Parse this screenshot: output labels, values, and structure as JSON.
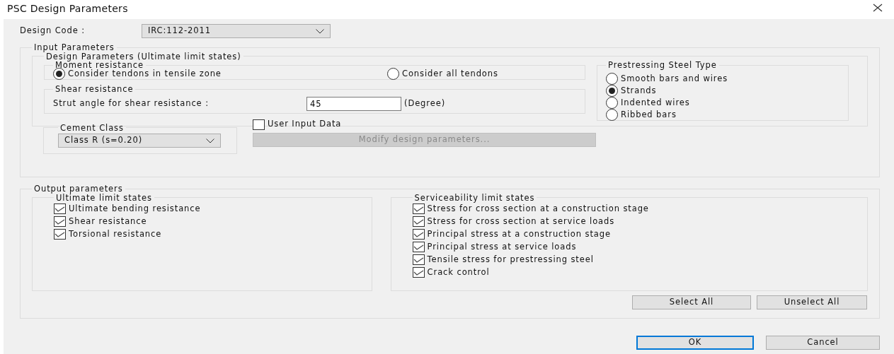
{
  "window": {
    "title": "PSC Design Parameters"
  },
  "design_code": {
    "label": "Design Code :",
    "value": "IRC:112-2011"
  },
  "input_parameters": {
    "title": "Input Parameters",
    "design_parameters": {
      "title": "Design Parameters (Ultimate limit states)",
      "moment_resistance": {
        "title": "Moment resistance",
        "options": [
          {
            "label": "Consider tendons in tensile zone",
            "selected": true
          },
          {
            "label": "Consider all tendons",
            "selected": false
          }
        ]
      },
      "shear_resistance": {
        "title": "Shear resistance",
        "label": "Strut angle for shear resistance :",
        "value": "45",
        "unit": "(Degree)"
      },
      "prestressing_steel_type": {
        "title": "Prestressing Steel Type",
        "options": [
          {
            "label": "Smooth bars and wires",
            "selected": false
          },
          {
            "label": "Strands",
            "selected": true
          },
          {
            "label": "Indented wires",
            "selected": false
          },
          {
            "label": "Ribbed bars",
            "selected": false
          }
        ]
      }
    },
    "cement_class": {
      "title": "Cement Class",
      "value": "Class R (s=0.20)"
    },
    "user_input_data": {
      "label": "User Input Data",
      "checked": false
    },
    "modify_button": {
      "label": "Modify design parameters...",
      "disabled": true
    }
  },
  "output_parameters": {
    "title": "Output parameters",
    "ultimate": {
      "title": "Ultimate limit states",
      "items": [
        {
          "label": "Ultimate bending resistance",
          "checked": true
        },
        {
          "label": "Shear resistance",
          "checked": true
        },
        {
          "label": "Torsional resistance",
          "checked": true
        }
      ]
    },
    "serviceability": {
      "title": "Serviceability limit states",
      "items": [
        {
          "label": "Stress for cross section at a construction stage",
          "checked": true
        },
        {
          "label": "Stress for cross section at service loads",
          "checked": true
        },
        {
          "label": "Principal stress at a construction stage",
          "checked": true
        },
        {
          "label": "Principal stress at service loads",
          "checked": true
        },
        {
          "label": "Tensile stress for prestressing steel",
          "checked": true
        },
        {
          "label": "Crack control",
          "checked": true
        }
      ]
    },
    "buttons": [
      "Select All",
      "Unselect All"
    ]
  },
  "footer_buttons": [
    {
      "label": "OK",
      "default": true
    },
    {
      "label": "Cancel",
      "default": false
    }
  ]
}
